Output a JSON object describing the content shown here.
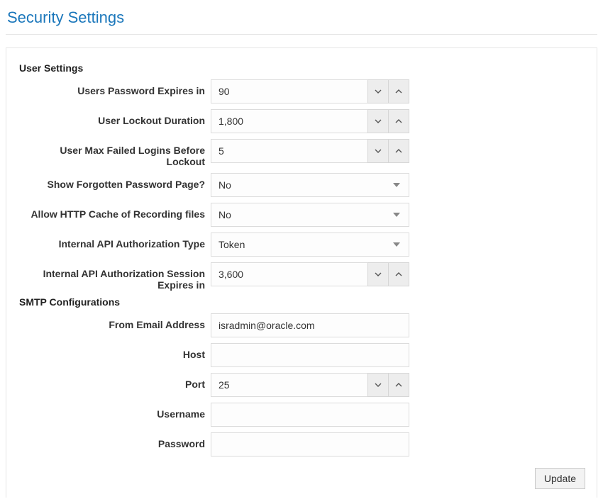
{
  "page": {
    "title": "Security Settings"
  },
  "buttons": {
    "update": "Update"
  },
  "userSettings": {
    "sectionTitle": "User Settings",
    "passwordExpires": {
      "label": "Users Password Expires in",
      "value": "90"
    },
    "lockoutDuration": {
      "label": "User Lockout Duration",
      "value": "1,800"
    },
    "maxFailedLogins": {
      "label": "User Max Failed Logins Before Lockout",
      "value": "5"
    },
    "showForgotten": {
      "label": "Show Forgotten Password Page?",
      "value": "No"
    },
    "allowHttpCache": {
      "label": "Allow HTTP Cache of Recording files",
      "value": "No"
    },
    "apiAuthType": {
      "label": "Internal API Authorization Type",
      "value": "Token"
    },
    "apiSessionExpires": {
      "label": "Internal API Authorization Session Expires in",
      "value": "3,600"
    }
  },
  "smtp": {
    "sectionTitle": "SMTP Configurations",
    "fromEmail": {
      "label": "From Email Address",
      "value": "isradmin@oracle.com"
    },
    "host": {
      "label": "Host",
      "value": ""
    },
    "port": {
      "label": "Port",
      "value": "25"
    },
    "username": {
      "label": "Username",
      "value": ""
    },
    "password": {
      "label": "Password",
      "value": ""
    }
  }
}
